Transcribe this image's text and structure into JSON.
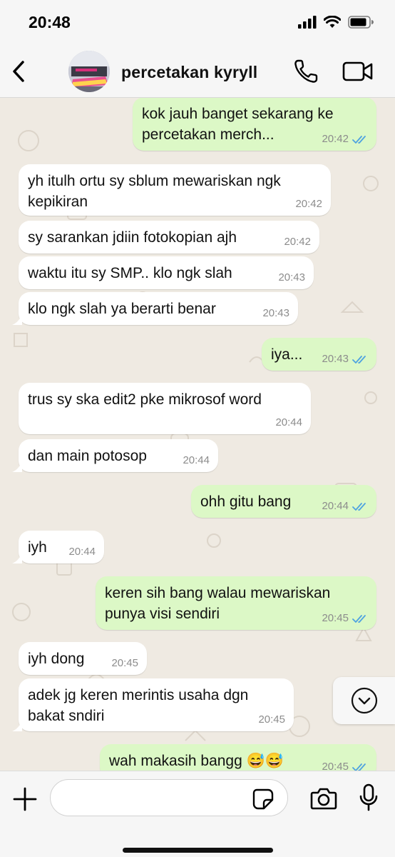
{
  "status": {
    "time": "20:48"
  },
  "header": {
    "contact_name": "percetakan kyryll",
    "back_icon": "chevron-left-icon",
    "call_icon": "phone-icon",
    "video_icon": "video-camera-icon"
  },
  "messages": [
    {
      "dir": "out",
      "text": "kok jauh banget sekarang ke percetakan merch...",
      "time": "20:42",
      "read": true
    },
    {
      "dir": "in",
      "text": "yh itulh ortu sy sblum mewariskan ngk kepikiran",
      "time": "20:42"
    },
    {
      "dir": "in",
      "text": "sy sarankan jdiin fotokopian ajh",
      "time": "20:42"
    },
    {
      "dir": "in",
      "text": "waktu itu sy SMP.. klo ngk slah",
      "time": "20:43"
    },
    {
      "dir": "in",
      "text": "klo ngk slah ya berarti benar",
      "time": "20:43"
    },
    {
      "dir": "out",
      "text": "iya...",
      "time": "20:43",
      "read": true
    },
    {
      "dir": "in",
      "text": "trus sy ska edit2 pke mikrosof word",
      "time": "20:44"
    },
    {
      "dir": "in",
      "text": "dan main potosop",
      "time": "20:44"
    },
    {
      "dir": "out",
      "text": "ohh gitu bang",
      "time": "20:44",
      "read": true
    },
    {
      "dir": "in",
      "text": "iyh",
      "time": "20:44"
    },
    {
      "dir": "out",
      "text": "keren sih bang walau mewariskan punya visi sendiri",
      "time": "20:45",
      "read": true
    },
    {
      "dir": "in",
      "text": "iyh dong",
      "time": "20:45"
    },
    {
      "dir": "in",
      "text": "adek jg keren merintis usaha dgn bakat sndiri",
      "time": "20:45"
    },
    {
      "dir": "out",
      "text": "wah makasih bangg 😅😅",
      "time": "20:45",
      "read": true
    }
  ],
  "input": {
    "placeholder": "",
    "value": ""
  },
  "colors": {
    "incoming_bubble": "#ffffff",
    "outgoing_bubble": "#dcf8c6",
    "chat_background": "#efeae2",
    "read_ticks": "#4fa3e0"
  }
}
